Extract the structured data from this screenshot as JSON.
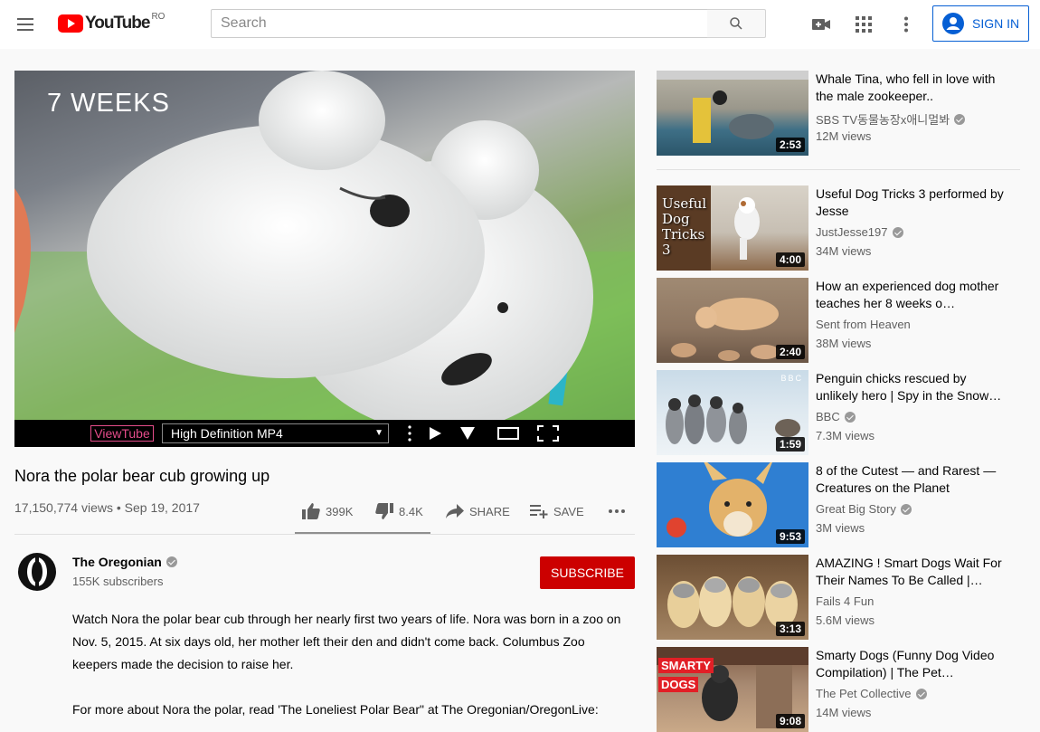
{
  "header": {
    "logo_text": "YouTube",
    "region": "RO",
    "search_placeholder": "Search",
    "signin_label": "SIGN IN"
  },
  "player": {
    "overlay_text": "7 WEEKS",
    "viewtube_label": "ViewTube",
    "quality_selected": "High Definition MP4"
  },
  "video": {
    "title": "Nora the polar bear cub growing up",
    "view_info": "17,150,774 views • Sep 19, 2017",
    "likes": "399K",
    "dislikes": "8.4K",
    "share_label": "SHARE",
    "save_label": "SAVE",
    "like_ratio": 0.979
  },
  "channel": {
    "name": "The Oregonian",
    "subscribers": "155K subscribers",
    "subscribe_label": "SUBSCRIBE"
  },
  "description": {
    "paragraph1": "Watch Nora the polar bear cub through her nearly first two years of life. Nora was born in a zoo on Nov. 5, 2015. At six days old, her mother left their den and didn't come back. Columbus Zoo keepers made the decision to raise her.",
    "paragraph2": "For more about Nora the polar, read 'The Loneliest Polar Bear\" at The Oregonian/OregonLive:"
  },
  "recommendations": [
    {
      "title": "Whale Tina, who fell in love with the male zookeeper..",
      "channel": "SBS TV동물농장x애니멀봐",
      "views": "12M views",
      "duration": "2:53"
    },
    {
      "title": "Useful Dog Tricks 3 performed by Jesse",
      "channel": "JustJesse197",
      "views": "34M views",
      "duration": "4:00",
      "thumb_text": "Useful Dog Tricks 3"
    },
    {
      "title": "How an experienced dog mother teaches her 8 weeks o…",
      "channel": "Sent from Heaven",
      "views": "38M views",
      "duration": "2:40"
    },
    {
      "title": "Penguin chicks rescued by unlikely hero | Spy in the Snow…",
      "channel": "BBC",
      "views": "7.3M views",
      "duration": "1:59",
      "thumb_text": "BBC"
    },
    {
      "title": "8 of the Cutest — and Rarest — Creatures on the Planet",
      "channel": "Great Big Story",
      "views": "3M views",
      "duration": "9:53"
    },
    {
      "title": "AMAZING ! Smart Dogs Wait For Their Names To Be Called |…",
      "channel": "Fails 4 Fun",
      "views": "5.6M views",
      "duration": "3:13"
    },
    {
      "title": "Smarty Dogs (Funny Dog Video Compilation) | The Pet…",
      "channel": "The Pet Collective",
      "views": "14M views",
      "duration": "9:08",
      "thumb_text_1": "SMARTY",
      "thumb_text_2": "DOGS"
    }
  ],
  "colors": {
    "accent_blue": "#065fd4",
    "subscribe_red": "#cc0000",
    "logo_red": "#ff0000",
    "viewtube_pink": "#e44c8a"
  }
}
